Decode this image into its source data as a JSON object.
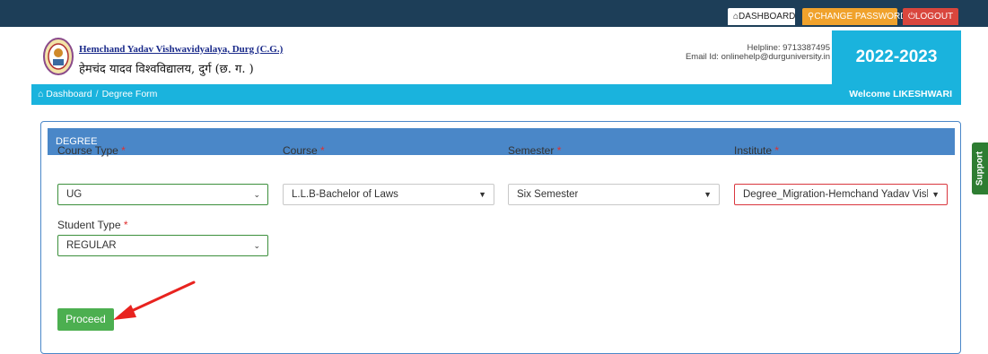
{
  "topbar": {
    "dashboard_label": "DASHBOARD",
    "change_password_label": "CHANGE PASSWORD",
    "logout_label": "LOGOUT"
  },
  "header": {
    "university_en": "Hemchand Yadav Vishwavidyalaya, Durg (C.G.)",
    "university_hi": "हेमचंद यादव विश्वविद्यालय, दुर्ग (छ. ग. )",
    "helpline": "Helpline: 9713387495",
    "email": "Email Id: onlinehelp@durguniversity.in",
    "session_year": "2022-2023"
  },
  "breadcrumb": {
    "home": "Dashboard",
    "separator": "/",
    "current": "Degree Form",
    "welcome": "Welcome LIKESHWARI"
  },
  "form": {
    "heading": "DEGREE",
    "required_mark": "*",
    "course_type": {
      "label": "Course Type",
      "value": "UG"
    },
    "course": {
      "label": "Course",
      "value": "L.L.B-Bachelor of Laws"
    },
    "semester": {
      "label": "Semester",
      "value": "Six Semester"
    },
    "institute": {
      "label": "Institute",
      "value": "Degree_Migration-Hemchand Yadav Vish"
    },
    "student_type": {
      "label": "Student Type",
      "value": "REGULAR"
    },
    "proceed_label": "Proceed"
  },
  "support_label": "Support",
  "icons": {
    "home": "home-icon",
    "key": "key-icon",
    "power": "power-icon",
    "chevron": "chevron-down-icon",
    "caret": "caret-down-icon",
    "annotation_arrow": "arrow-icon"
  },
  "colors": {
    "topbar": "#1d3e58",
    "accent": "#1ab3dd",
    "card_header": "#4a87c8",
    "proceed": "#4caf50",
    "warning": "#f0a22c",
    "danger": "#d9463d",
    "arrow": "#e8231f"
  }
}
